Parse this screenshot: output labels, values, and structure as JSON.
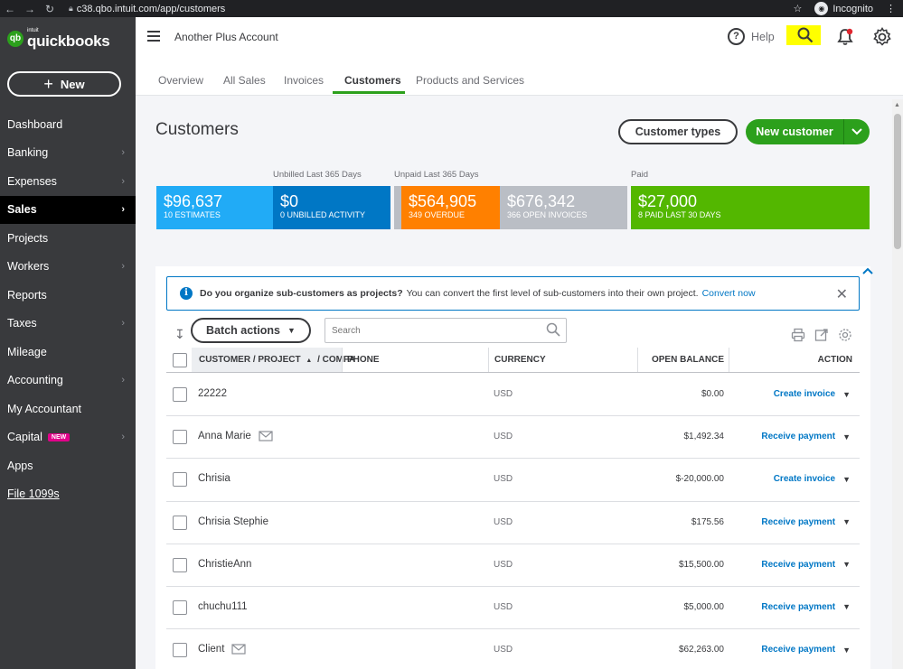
{
  "browser": {
    "url": "c38.qbo.intuit.com/app/customers",
    "profile": "Incognito"
  },
  "brand": {
    "intuit": "intuit",
    "name": "quickbooks",
    "color": "#2ca01c"
  },
  "sidebar": {
    "new_label": "New",
    "items": [
      {
        "label": "Dashboard",
        "chevron": false
      },
      {
        "label": "Banking",
        "chevron": true
      },
      {
        "label": "Expenses",
        "chevron": true
      },
      {
        "label": "Sales",
        "chevron": true,
        "active": true
      },
      {
        "label": "Projects",
        "chevron": false
      },
      {
        "label": "Workers",
        "chevron": true
      },
      {
        "label": "Reports",
        "chevron": false
      },
      {
        "label": "Taxes",
        "chevron": true
      },
      {
        "label": "Mileage",
        "chevron": false
      },
      {
        "label": "Accounting",
        "chevron": true
      },
      {
        "label": "My Accountant",
        "chevron": false
      },
      {
        "label": "Capital",
        "chevron": true,
        "badge": "NEW"
      },
      {
        "label": "Apps",
        "chevron": false
      },
      {
        "label": "File 1099s",
        "chevron": false,
        "link": true
      }
    ]
  },
  "header": {
    "company": "Another Plus Account",
    "help": "Help"
  },
  "tabs": [
    "Overview",
    "All Sales",
    "Invoices",
    "Customers",
    "Products and Services"
  ],
  "page": {
    "title": "Customers",
    "customer_types": "Customer types",
    "new_customer": "New customer"
  },
  "money_bar": {
    "unbilled_label": "Unbilled Last 365 Days",
    "unpaid_label": "Unpaid Last 365 Days",
    "paid_label": "Paid",
    "estimates": {
      "amount": "$96,637",
      "sub": "10 ESTIMATES",
      "color": "#21abf6"
    },
    "unbilled": {
      "amount": "$0",
      "sub": "0 UNBILLED ACTIVITY",
      "color": "#0077c5"
    },
    "overdue": {
      "amount": "$564,905",
      "sub": "349 OVERDUE",
      "color": "#ff8000"
    },
    "open_invoices": {
      "amount": "$676,342",
      "sub": "366 OPEN INVOICES",
      "color": "#babec5"
    },
    "paid": {
      "amount": "$27,000",
      "sub": "8 PAID LAST 30 DAYS",
      "color": "#53b700"
    }
  },
  "banner": {
    "bold": "Do you organize sub-customers as projects?",
    "text": "You can convert the first level of sub-customers into their own project.",
    "link": "Convert now"
  },
  "table": {
    "batch_actions": "Batch actions",
    "search_placeholder": "Search",
    "headers": {
      "customer": "CUSTOMER / PROJECT",
      "company": "/ COMPA",
      "phone": "PHONE",
      "currency": "CURRENCY",
      "balance": "OPEN BALANCE",
      "action": "ACTION"
    },
    "rows": [
      {
        "name": "22222",
        "email": false,
        "currency": "USD",
        "balance": "$0.00",
        "action": "Create invoice"
      },
      {
        "name": "Anna Marie",
        "email": true,
        "currency": "USD",
        "balance": "$1,492.34",
        "action": "Receive payment"
      },
      {
        "name": "Chrisia",
        "email": false,
        "currency": "USD",
        "balance": "$-20,000.00",
        "action": "Create invoice"
      },
      {
        "name": "Chrisia Stephie",
        "email": false,
        "currency": "USD",
        "balance": "$175.56",
        "action": "Receive payment"
      },
      {
        "name": "ChristieAnn",
        "email": false,
        "currency": "USD",
        "balance": "$15,500.00",
        "action": "Receive payment"
      },
      {
        "name": "chuchu111",
        "email": false,
        "currency": "USD",
        "balance": "$5,000.00",
        "action": "Receive payment"
      },
      {
        "name": "Client",
        "email": true,
        "currency": "USD",
        "balance": "$62,263.00",
        "action": "Receive payment"
      }
    ]
  }
}
